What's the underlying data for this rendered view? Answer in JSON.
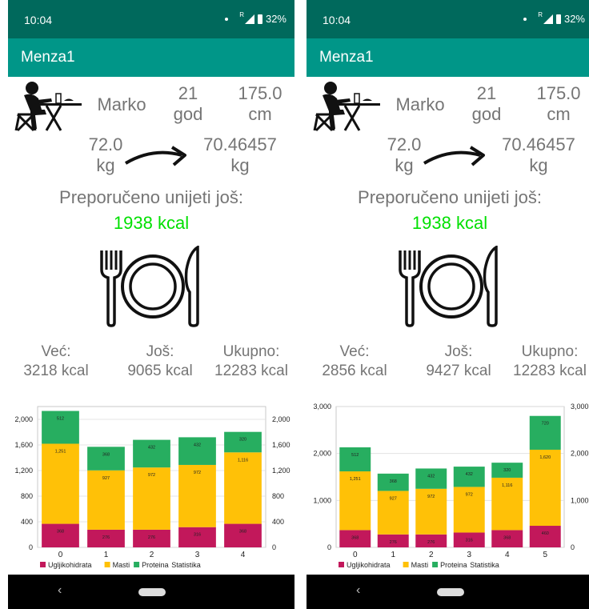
{
  "screens": [
    {
      "status": {
        "time": "10:04",
        "battery": "32%",
        "signal_label": "R"
      },
      "app": {
        "title": "Menza1"
      },
      "profile": {
        "name": "Marko",
        "age": "21",
        "age_unit": "god",
        "height": "175.0",
        "height_unit": "cm",
        "weight": "72.0",
        "weight_unit": "kg",
        "target": "70.46457",
        "target_unit": "kg"
      },
      "recommend": {
        "label": "Preporučeno unijeti još:",
        "kcal": "1938 kcal"
      },
      "stats": [
        {
          "label": "Već:",
          "value": "3218 kcal"
        },
        {
          "label": "Još:",
          "value": "9065 kcal"
        },
        {
          "label": "Ukupno:",
          "value": "12283 kcal"
        }
      ],
      "chart_data": {
        "type": "bar",
        "stacked": true,
        "categories": [
          "0",
          "1",
          "2",
          "3",
          "4"
        ],
        "series": [
          {
            "name": "Ugljikohidrata",
            "color": "#c2185b",
            "values": [
              368,
              276,
              276,
              316,
              368
            ]
          },
          {
            "name": "Masti",
            "color": "#ffc107",
            "values": [
              1251,
              927,
              972,
              972,
              1116
            ]
          },
          {
            "name": "Proteina",
            "color": "#27ae60",
            "values": [
              512,
              368,
              432,
              432,
              320
            ]
          }
        ],
        "value_labels": [
          [
            "368",
            "276",
            "276",
            "316",
            "368"
          ],
          [
            "1,251",
            "927",
            "972",
            "972",
            "1,116"
          ],
          [
            "512",
            "368",
            "432",
            "432",
            "320"
          ]
        ],
        "yticks": [
          "0",
          "400",
          "800",
          "1,200",
          "1,600",
          "2,000"
        ],
        "right_ticks": [
          "0",
          "400",
          "800",
          "1,200",
          "1,600",
          "2,000"
        ],
        "ylim": [
          0,
          2200
        ],
        "legend_extra": "Statistika",
        "legend_position": "bottom-left"
      }
    },
    {
      "status": {
        "time": "10:04",
        "battery": "32%",
        "signal_label": "R"
      },
      "app": {
        "title": "Menza1"
      },
      "profile": {
        "name": "Marko",
        "age": "21",
        "age_unit": "god",
        "height": "175.0",
        "height_unit": "cm",
        "weight": "72.0",
        "weight_unit": "kg",
        "target": "70.46457",
        "target_unit": "kg"
      },
      "recommend": {
        "label": "Preporučeno unijeti još:",
        "kcal": "1938 kcal"
      },
      "stats": [
        {
          "label": "Već:",
          "value": "2856 kcal"
        },
        {
          "label": "Još:",
          "value": "9427 kcal"
        },
        {
          "label": "Ukupno:",
          "value": "12283 kcal"
        }
      ],
      "chart_data": {
        "type": "bar",
        "stacked": true,
        "categories": [
          "0",
          "1",
          "2",
          "3",
          "4",
          "5"
        ],
        "series": [
          {
            "name": "Ugljikohidrata",
            "color": "#c2185b",
            "values": [
              368,
              276,
              276,
              316,
              368,
              460
            ]
          },
          {
            "name": "Masti",
            "color": "#ffc107",
            "values": [
              1251,
              927,
              972,
              972,
              1116,
              1620
            ]
          },
          {
            "name": "Proteina",
            "color": "#27ae60",
            "values": [
              512,
              368,
              432,
              432,
              320,
              720
            ]
          }
        ],
        "value_labels": [
          [
            "368",
            "276",
            "276",
            "316",
            "368",
            "460"
          ],
          [
            "1,251",
            "927",
            "972",
            "972",
            "1,116",
            "1,620"
          ],
          [
            "512",
            "368",
            "432",
            "432",
            "320",
            "720"
          ]
        ],
        "yticks": [
          "0",
          "1,000",
          "2,000",
          "3,000"
        ],
        "right_ticks": [
          "0",
          "1,000",
          "2,000",
          "3,000"
        ],
        "ylim": [
          0,
          3000
        ],
        "legend_extra": "Statistika",
        "legend_position": "bottom-left"
      }
    }
  ]
}
